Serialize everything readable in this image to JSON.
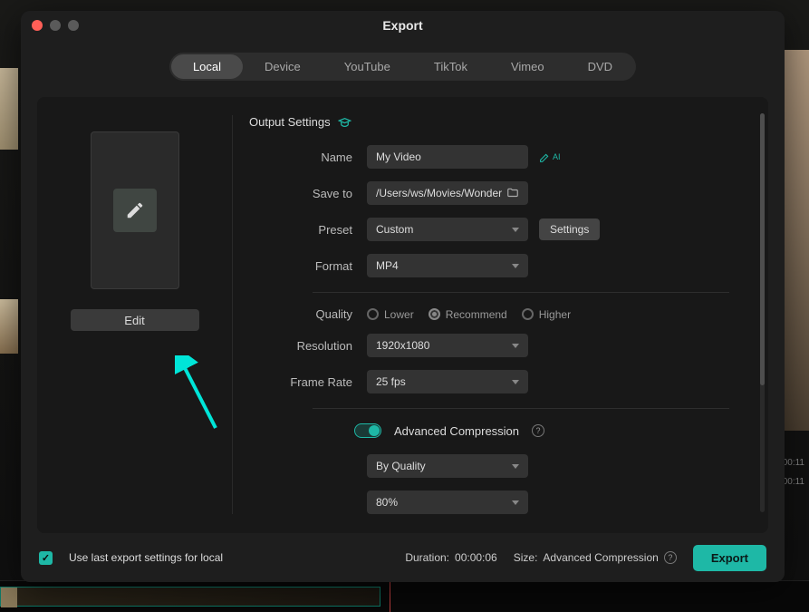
{
  "window": {
    "title": "Export"
  },
  "tabs": [
    "Local",
    "Device",
    "YouTube",
    "TikTok",
    "Vimeo",
    "DVD"
  ],
  "active_tab": 0,
  "sidebar": {
    "edit_label": "Edit"
  },
  "output": {
    "section_title": "Output Settings",
    "name_label": "Name",
    "name_value": "My Video",
    "saveto_label": "Save to",
    "saveto_value": "/Users/ws/Movies/Wonder",
    "preset_label": "Preset",
    "preset_value": "Custom",
    "settings_label": "Settings",
    "format_label": "Format",
    "format_value": "MP4",
    "quality_label": "Quality",
    "quality_options": [
      "Lower",
      "Recommend",
      "Higher"
    ],
    "quality_selected": 1,
    "resolution_label": "Resolution",
    "resolution_value": "1920x1080",
    "framerate_label": "Frame Rate",
    "framerate_value": "25 fps",
    "adv_label": "Advanced Compression",
    "adv_mode_value": "By Quality",
    "adv_pct_value": "80%"
  },
  "footer": {
    "uselast_label": "Use last export settings for local",
    "duration_label": "Duration:",
    "duration_value": "00:00:06",
    "size_label": "Size:",
    "size_value": "Advanced Compression",
    "export_label": "Export"
  },
  "bg": {
    "time1": "00:11",
    "time2": "00:11"
  }
}
